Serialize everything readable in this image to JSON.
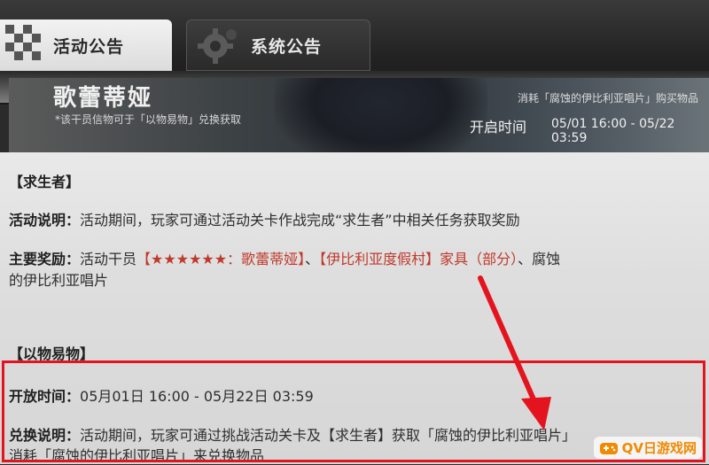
{
  "tabs": {
    "activity_label": "活动公告",
    "system_label": "系统公告"
  },
  "banner": {
    "title": "歌蕾蒂娅",
    "note": "*该干员信物可于「以物易物」兑换获取",
    "right_note": "消耗「腐蚀的伊比利亚唱片」购买物品",
    "open_time_label": "开启时间",
    "open_time_value": "05/01 16:00 - 05/22 03:59"
  },
  "content": {
    "survivor_heading": "【求生者】",
    "activity_desc_label": "活动说明：",
    "activity_desc_text": "活动期间，玩家可通过活动关卡作战完成“求生者”中相关任务获取奖励",
    "rewards_label": "主要奖励：",
    "rewards_prefix": "活动干员",
    "rewards_operator": "【★★★★★★：歌蕾蒂娅】",
    "rewards_sep1": "、",
    "rewards_furniture": "【伊比利亚度假村】家具（部分）",
    "rewards_suffix": "、腐蚀",
    "rewards_line2": "的伊比利亚唱片",
    "barter_heading": "【以物易物】",
    "open_time_label": "开放时间：",
    "open_time_text": "05月01日 16:00 - 05月22日 03:59",
    "exchange_label": "兑换说明：",
    "exchange_text": "活动期间，玩家可通过挑战活动关卡及【求生者】获取「腐蚀的伊比利亚唱片」",
    "exchange_line2": "消耗「腐蚀的伊比利亚唱片」来兑换物品"
  },
  "watermark": {
    "text": "QV日游戏网"
  },
  "colors": {
    "highlight": "#e4141f",
    "reward_red": "#c0392b"
  }
}
